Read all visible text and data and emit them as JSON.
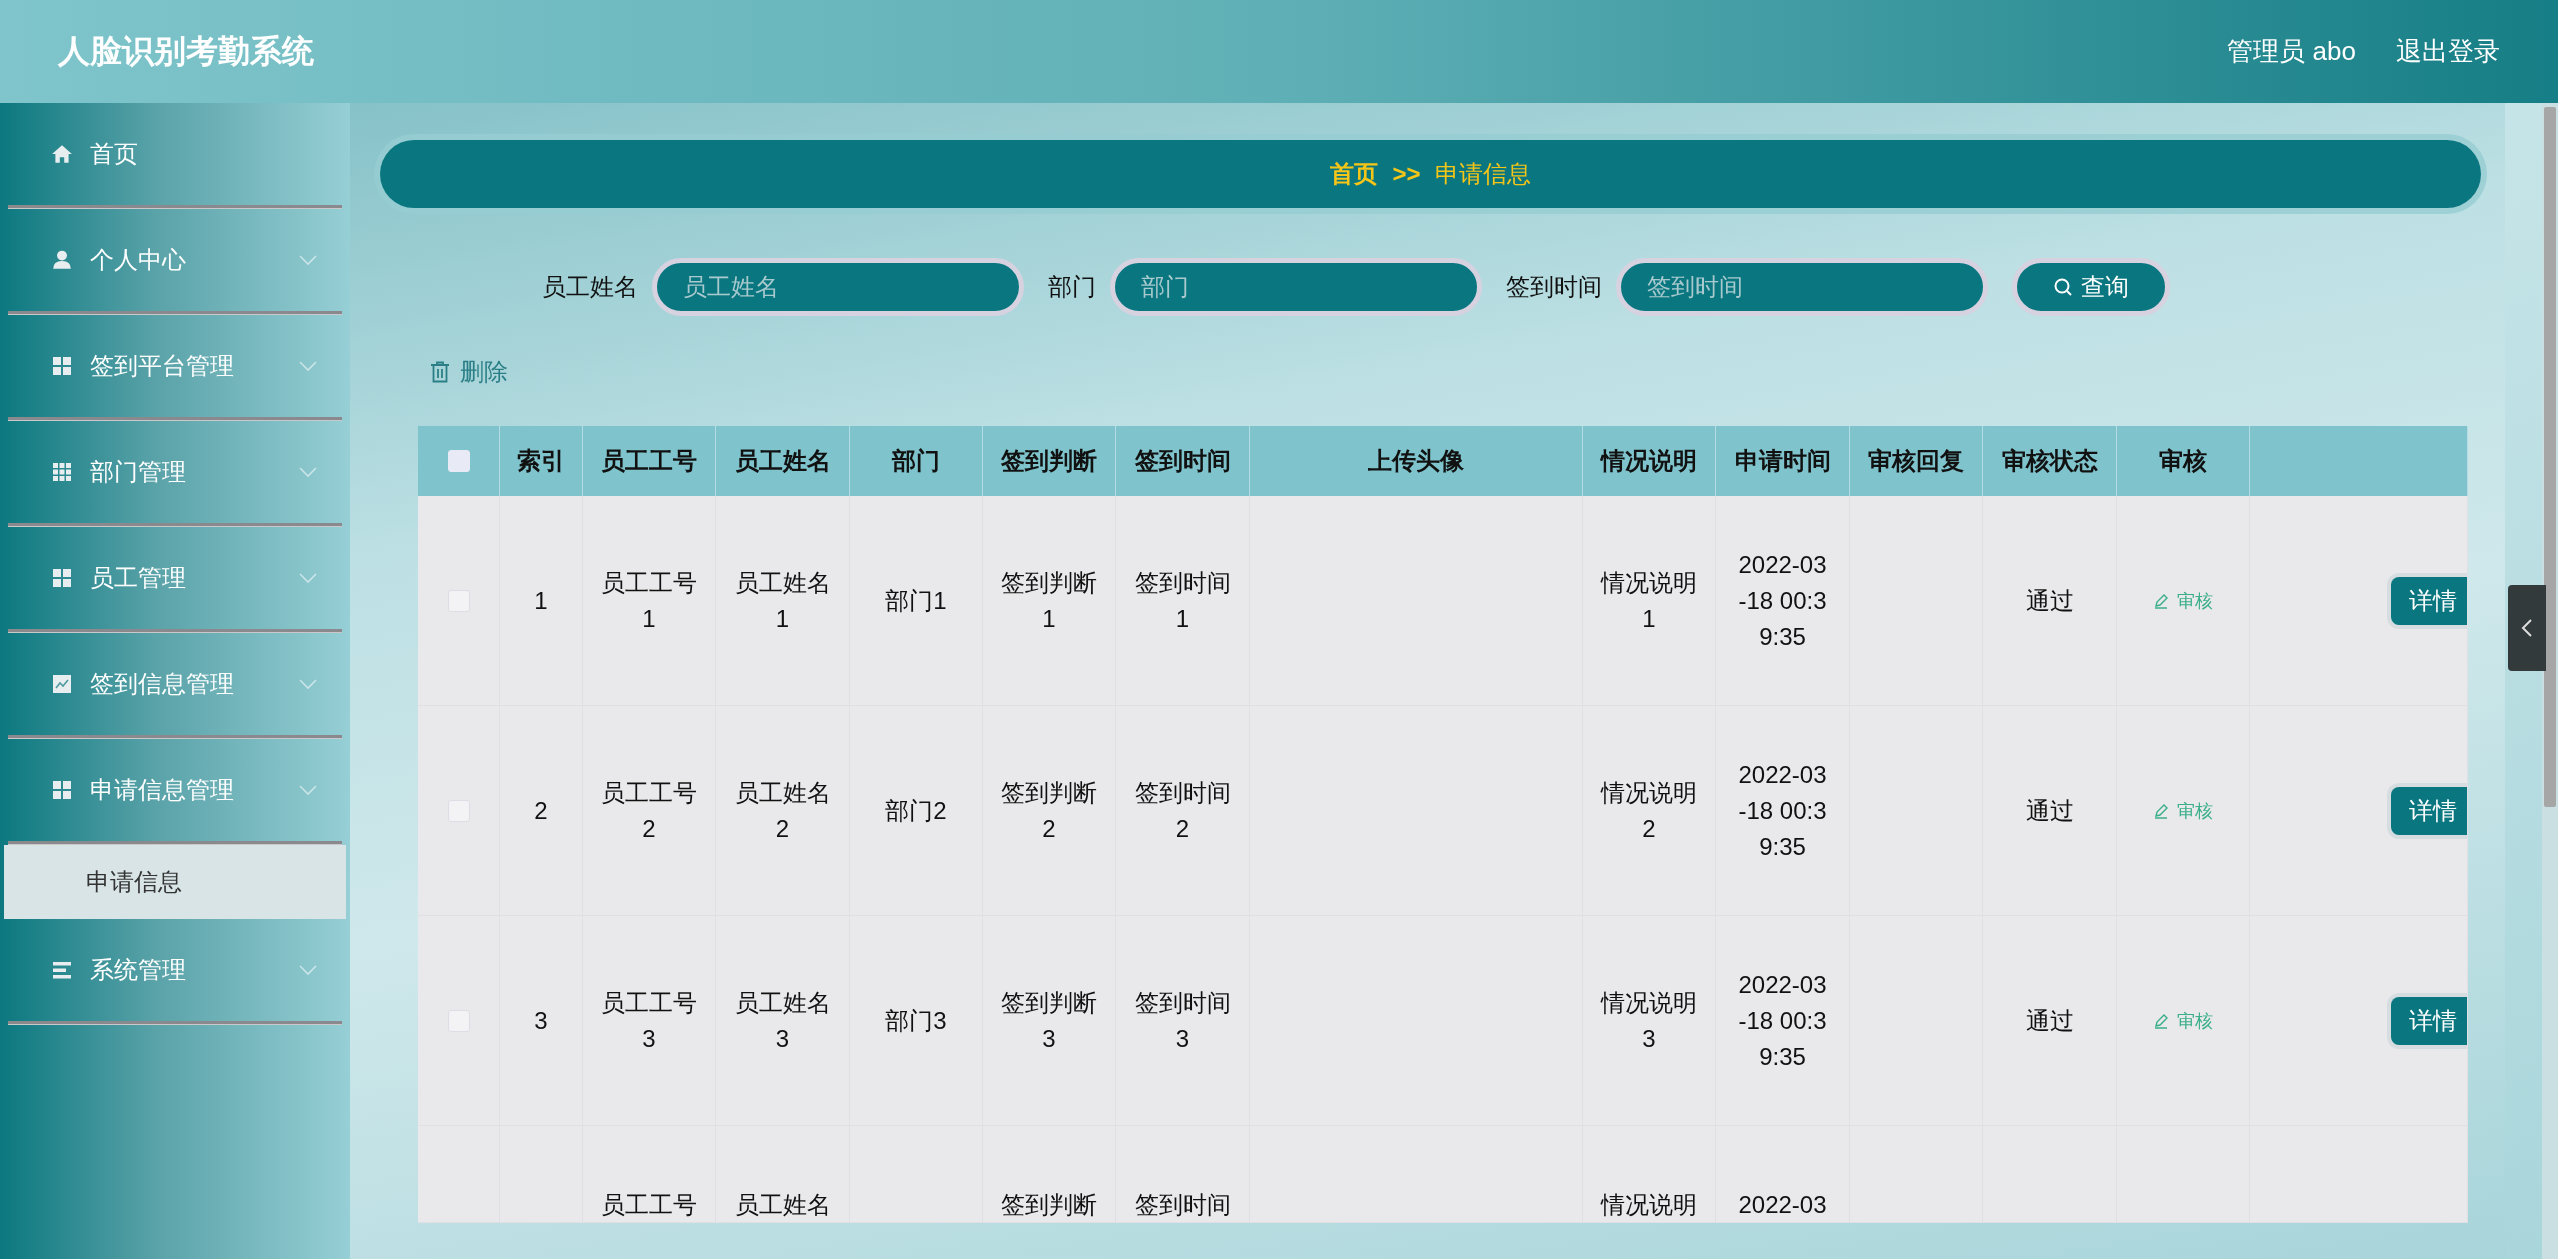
{
  "header": {
    "title": "人脸识别考勤系统",
    "user": "管理员 abo",
    "logout": "退出登录"
  },
  "sidebar": {
    "items": [
      {
        "label": "首页"
      },
      {
        "label": "个人中心"
      },
      {
        "label": "签到平台管理"
      },
      {
        "label": "部门管理"
      },
      {
        "label": "员工管理"
      },
      {
        "label": "签到信息管理"
      },
      {
        "label": "申请信息管理",
        "expanded": true,
        "children": [
          {
            "label": "申请信息",
            "selected": true
          }
        ]
      },
      {
        "label": "系统管理"
      }
    ]
  },
  "breadcrumb": {
    "home": "首页",
    "separator": ">>",
    "current": "申请信息"
  },
  "search": {
    "fields": [
      {
        "label": "员工姓名",
        "placeholder": "员工姓名"
      },
      {
        "label": "部门",
        "placeholder": "部门"
      },
      {
        "label": "签到时间",
        "placeholder": "签到时间"
      }
    ],
    "button": "查询"
  },
  "delete_button": "删除",
  "table": {
    "select_all": {
      "checked": false
    },
    "columns": [
      "索引",
      "员工工号",
      "员工姓名",
      "部门",
      "签到判断",
      "签到时间",
      "上传头像",
      "情况说明",
      "申请时间",
      "审核回复",
      "审核状态",
      "审核"
    ],
    "rows": [
      {
        "kind": "full",
        "checked": false,
        "index": "1",
        "employee_id": "员工工号1",
        "employee_name": "员工姓名1",
        "department": "部门1",
        "sign_judgement": "签到判断1",
        "sign_time": "签到时间1",
        "note": "情况说明1",
        "apply_time": "2022-03-18 00:39:35",
        "status": "通过",
        "review": "审核",
        "detail": "详情"
      },
      {
        "kind": "full",
        "checked": false,
        "index": "2",
        "employee_id": "员工工号2",
        "employee_name": "员工姓名2",
        "department": "部门2",
        "sign_judgement": "签到判断2",
        "sign_time": "签到时间2",
        "note": "情况说明2",
        "apply_time": "2022-03-18 00:39:35",
        "status": "通过",
        "review": "审核",
        "detail": "详情"
      },
      {
        "kind": "full",
        "checked": false,
        "index": "3",
        "employee_id": "员工工号3",
        "employee_name": "员工姓名3",
        "department": "部门3",
        "sign_judgement": "签到判断3",
        "sign_time": "签到时间3",
        "note": "情况说明3",
        "apply_time": "2022-03-18 00:39:35",
        "status": "通过",
        "review": "审核",
        "detail": "详情"
      },
      {
        "kind": "partial",
        "employee_id": "员工工号",
        "employee_name": "员工姓名",
        "sign_judgement": "签到判断",
        "sign_time": "签到时间",
        "note": "情况说明",
        "apply_time": "2022-03"
      }
    ]
  }
}
